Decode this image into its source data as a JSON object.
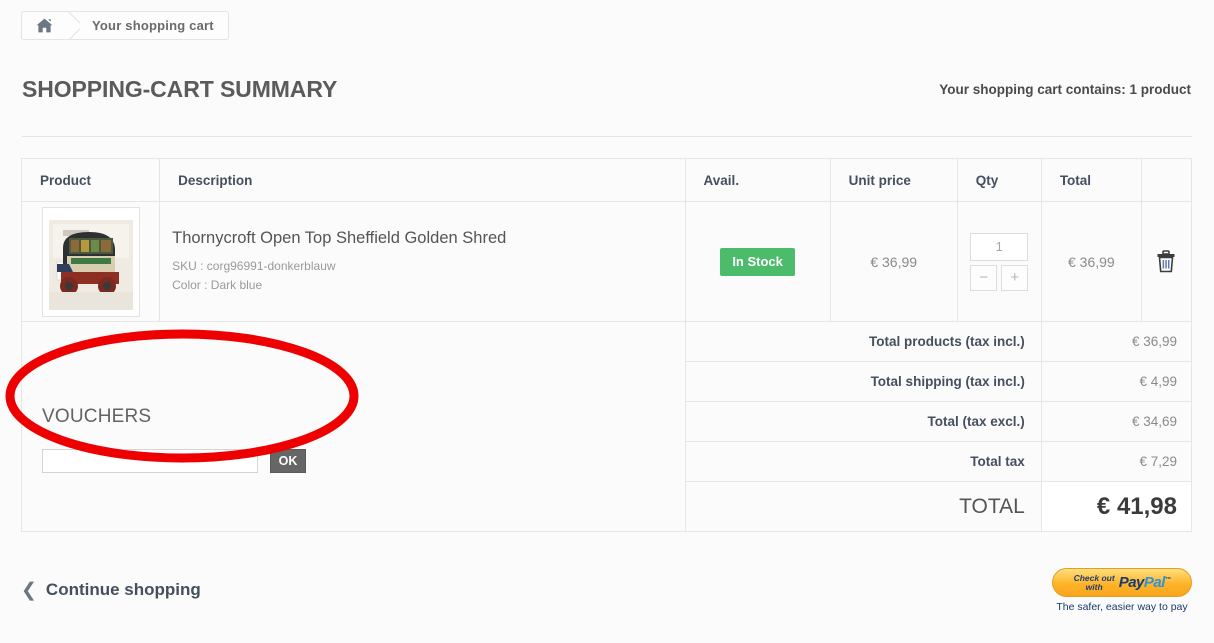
{
  "breadcrumb": {
    "home_icon": "home-icon",
    "current": "Your shopping cart"
  },
  "header": {
    "title": "SHOPPING-CART SUMMARY",
    "cart_count": "Your shopping cart contains: 1 product"
  },
  "table": {
    "headers": {
      "product": "Product",
      "description": "Description",
      "avail": "Avail.",
      "unit_price": "Unit price",
      "qty": "Qty",
      "total": "Total",
      "actions": ""
    },
    "rows": [
      {
        "thumb_icon": "product-thumbnail",
        "name": "Thornycroft Open Top Sheffield Golden Shred",
        "sku": "SKU : corg96991-donkerblauw",
        "color": "Color : Dark blue",
        "availability": "In Stock",
        "availability_color": "#4cbb6c",
        "unit_price": "€ 36,99",
        "qty": "1",
        "qty_minus": "−",
        "qty_plus": "+",
        "total": "€ 36,99",
        "delete_icon": "trash-icon"
      }
    ]
  },
  "vouchers": {
    "title": "VOUCHERS",
    "input_value": "",
    "input_placeholder": "",
    "ok_label": "OK"
  },
  "totals": [
    {
      "label": "Total products (tax incl.)",
      "value": "€ 36,99"
    },
    {
      "label": "Total shipping (tax incl.)",
      "value": "€ 4,99"
    },
    {
      "label": "Total (tax excl.)",
      "value": "€ 34,69"
    },
    {
      "label": "Total tax",
      "value": "€ 7,29"
    }
  ],
  "grand_total": {
    "label": "TOTAL",
    "value": "€ 41,98"
  },
  "footer": {
    "continue_icon": "chevron-left-icon",
    "continue_label": "Continue shopping",
    "paypal": {
      "check_out": "Check out",
      "with": "with",
      "pay": "Pay",
      "pal": "Pal",
      "tagline": "The safer, easier way to pay"
    }
  },
  "annotation": {
    "shape": "ellipse-highlight",
    "color": "#ee0000"
  }
}
